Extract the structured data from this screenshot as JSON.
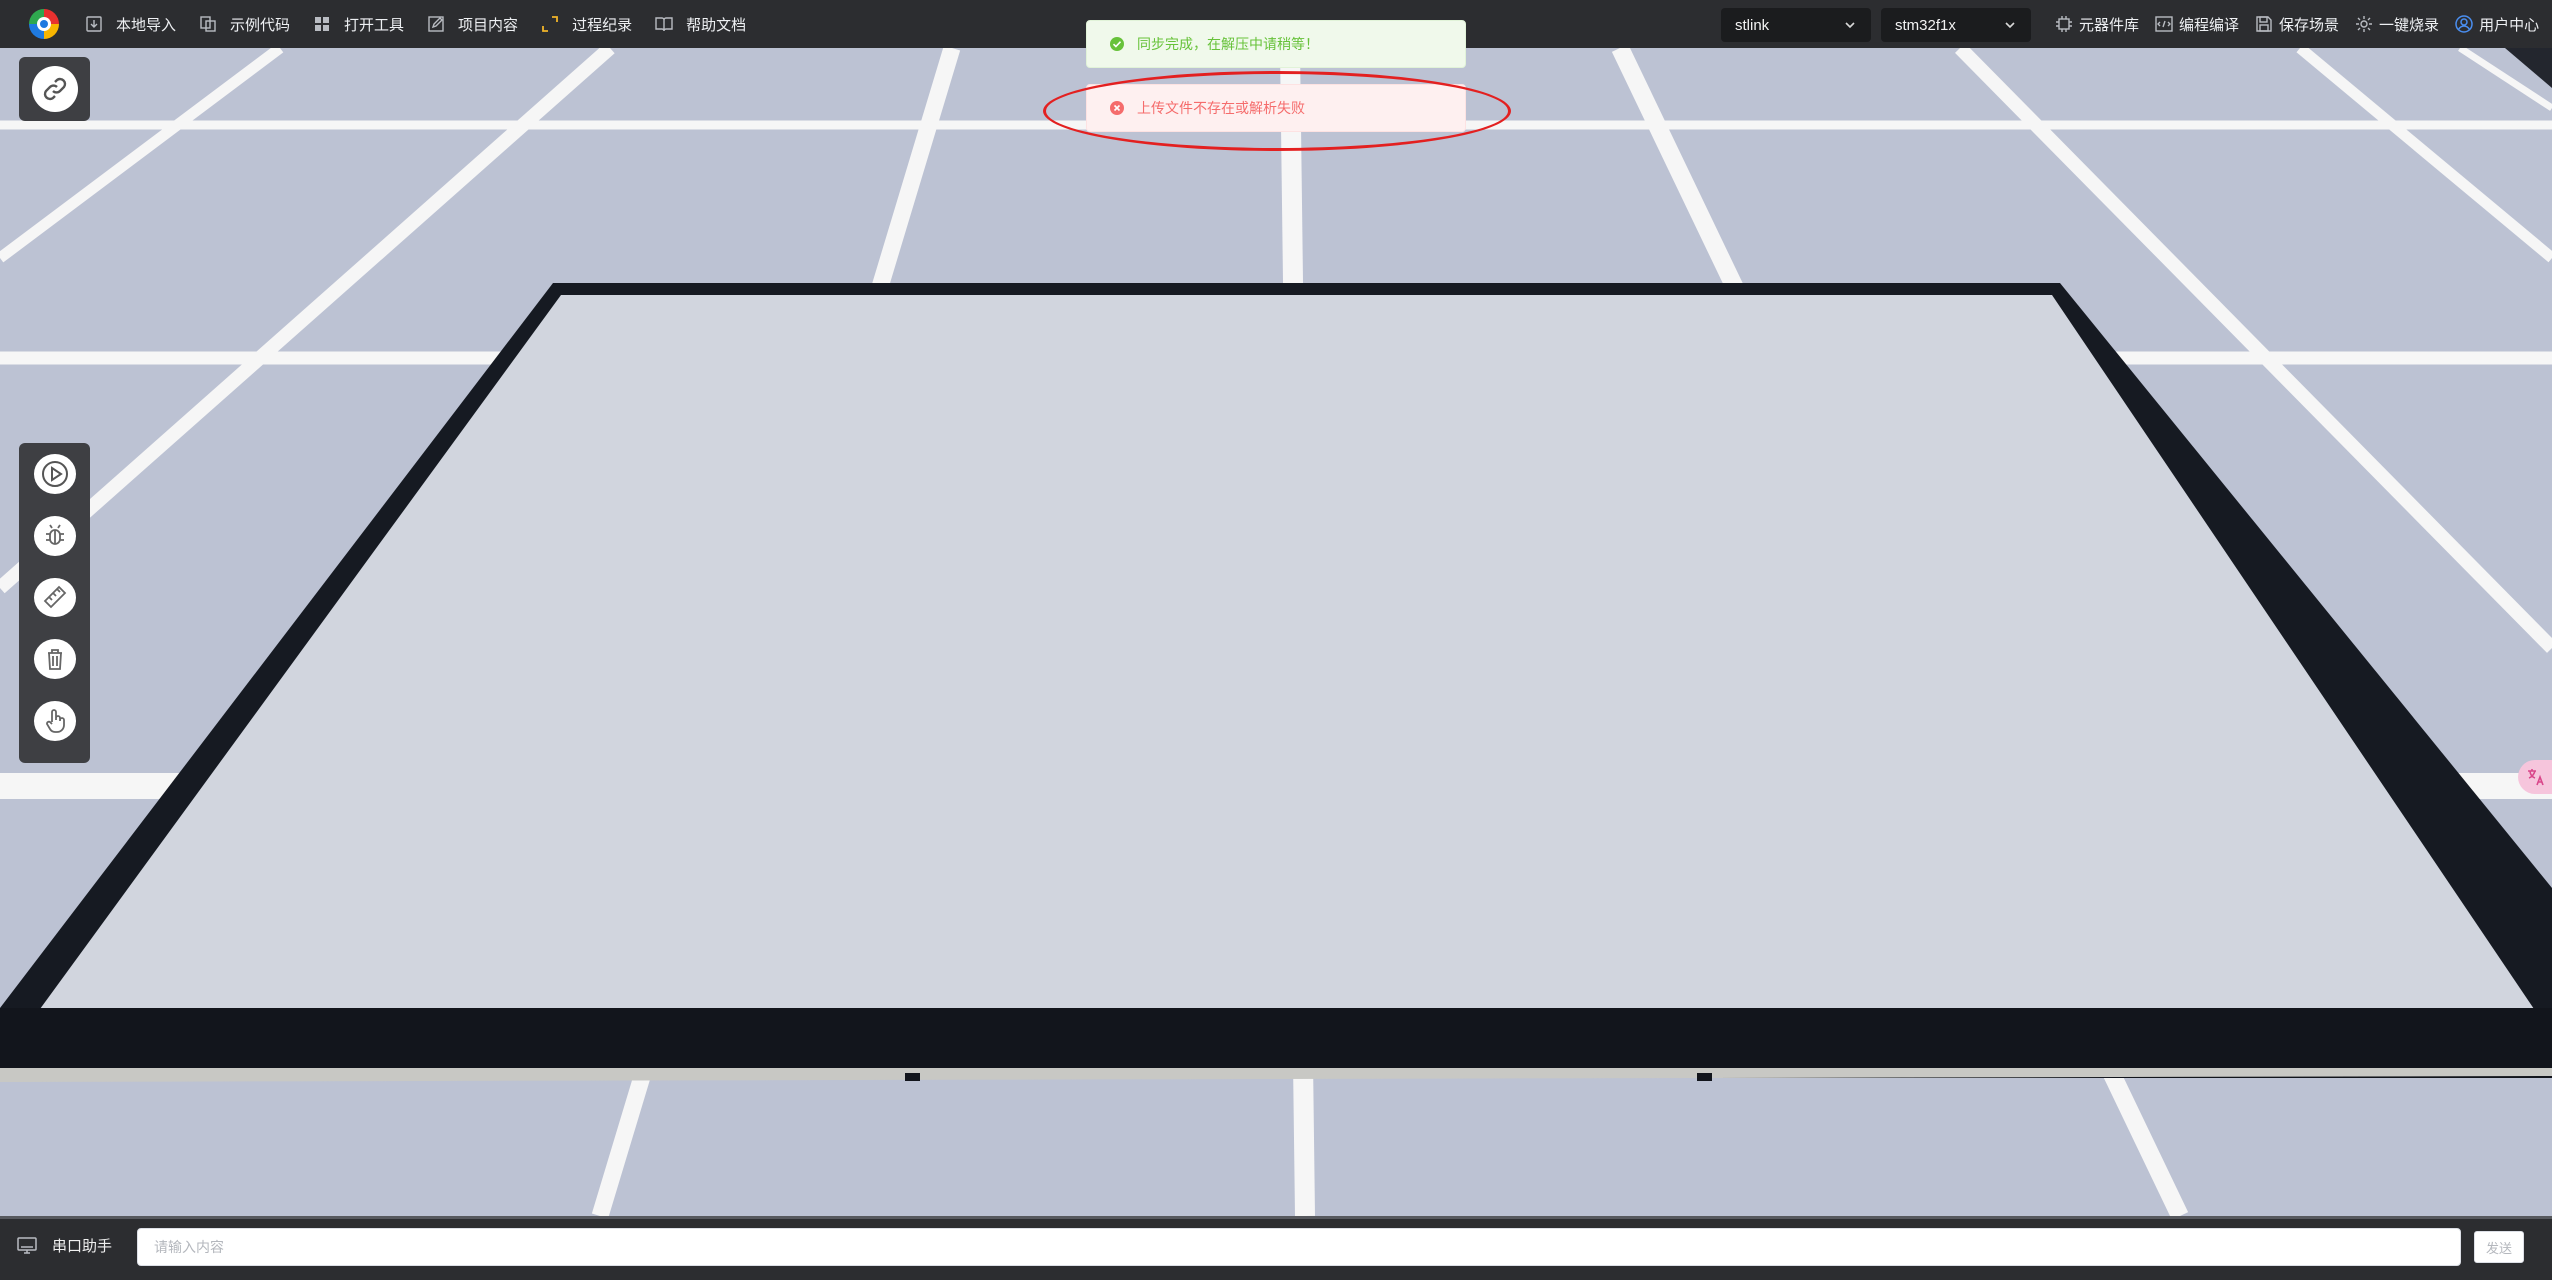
{
  "topbar": {
    "menu": [
      {
        "label": "本地导入",
        "icon": "import-icon"
      },
      {
        "label": "示例代码",
        "icon": "copy-icon"
      },
      {
        "label": "打开工具",
        "icon": "apps-grid-icon"
      },
      {
        "label": "项目内容",
        "icon": "edit-icon"
      },
      {
        "label": "过程纪录",
        "icon": "expand-icon"
      },
      {
        "label": "帮助文档",
        "icon": "book-icon"
      }
    ],
    "debugger_select": "stlink",
    "chip_select": "stm32f1x",
    "right_menu": [
      {
        "label": "元器件库",
        "icon": "chip-icon"
      },
      {
        "label": "编程编译",
        "icon": "code-compile-icon"
      },
      {
        "label": "保存场景",
        "icon": "save-icon"
      },
      {
        "label": "一键烧录",
        "icon": "cog-burn-icon"
      },
      {
        "label": "用户中心",
        "icon": "user-icon"
      }
    ]
  },
  "notifications": {
    "success": "同步完成，在解压中请稍等！",
    "error": "上传文件不存在或解析失败"
  },
  "serial": {
    "label": "串口助手",
    "placeholder": "请输入内容",
    "send_label": "发送"
  },
  "colors": {
    "topbar_bg": "#2c2d30",
    "ground": "#bcc2d3",
    "board_surface": "#d1d5de",
    "board_frame": "#161a22",
    "success": "#67c23a",
    "error": "#f56c6c",
    "highlight": "#e32020"
  }
}
